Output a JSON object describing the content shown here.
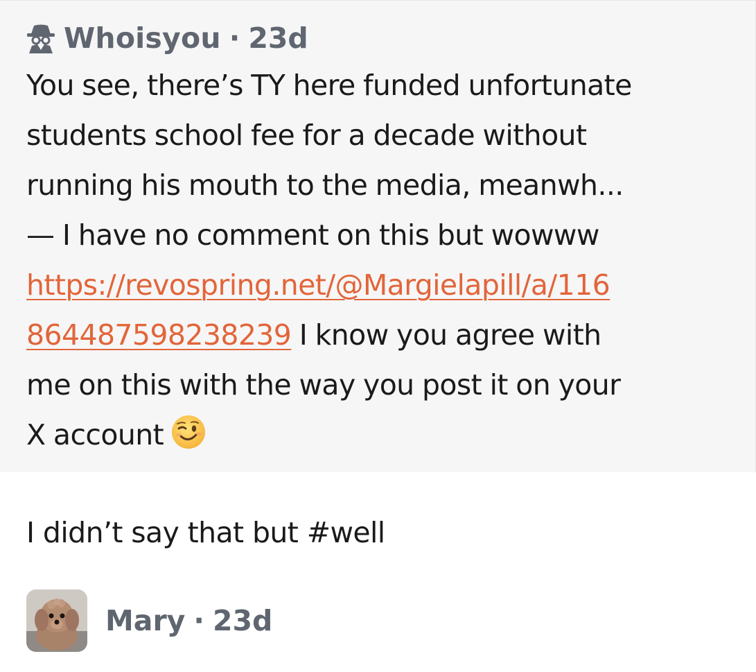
{
  "question": {
    "author": "Whoisyou",
    "separator": "·",
    "age": "23d",
    "author_icon": "spy-icon",
    "lines": [
      "You see, there’s TY here funded unfortunate",
      "students school fee for a decade without",
      "running his mouth to the media, meanwh...",
      "— I have no comment on this but wowww"
    ],
    "link_part1": "https://revospring.net/@Margielapill/a/116",
    "link_part2": "864487598238239",
    "after_link": " I know you agree with",
    "line7": "me on this with the way you post it on your",
    "line8": "X account",
    "emoji": "winking-face-emoji"
  },
  "answer": {
    "text": "I didn’t say that but #well",
    "author": "Mary",
    "separator": "·",
    "age": "23d",
    "avatar": "dog-avatar"
  },
  "colors": {
    "quote_background": "#f6f6f6",
    "link": "#e2653a",
    "meta_text": "#5f6670",
    "body_text": "#1a1a1a"
  }
}
